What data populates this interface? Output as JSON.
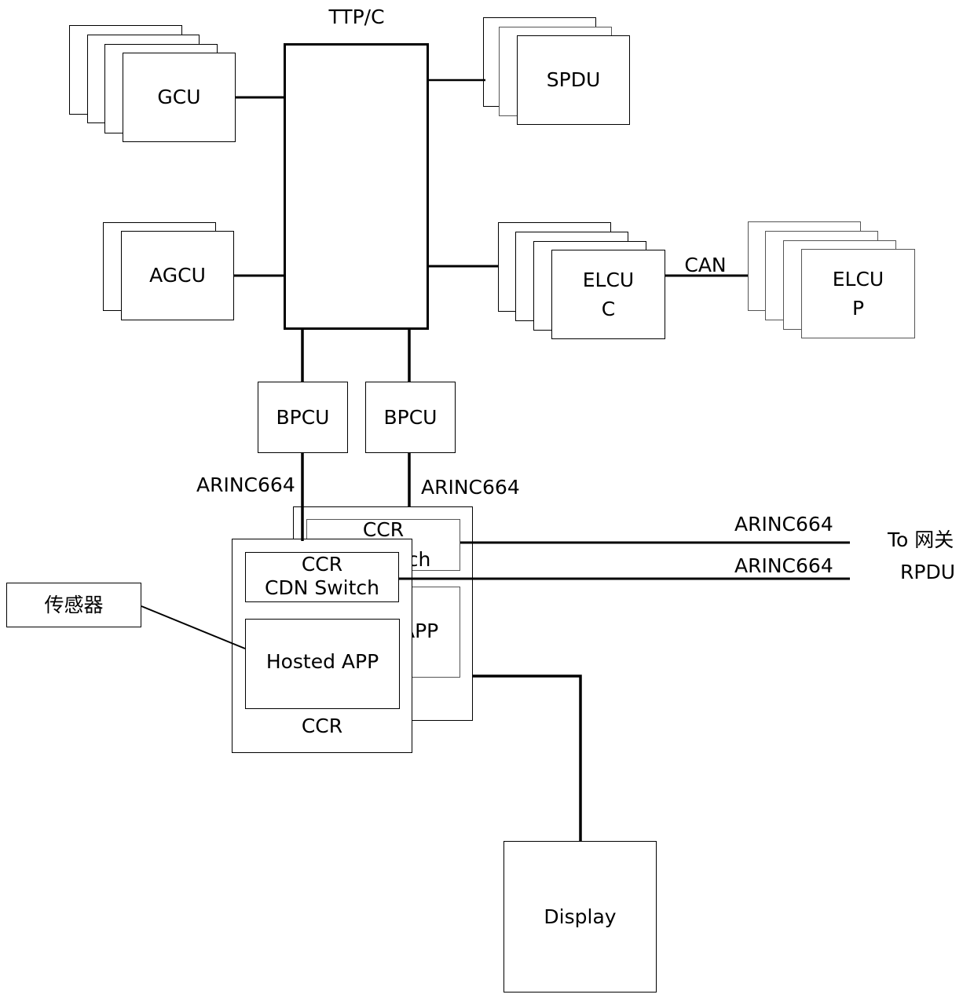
{
  "diagram": {
    "bus": {
      "label": "TTP/C"
    },
    "gcu": {
      "label": "GCU"
    },
    "agcu": {
      "label": "AGCU"
    },
    "spdu": {
      "label": "SPDU"
    },
    "elcu_c": {
      "line1": "ELCU",
      "line2": "C"
    },
    "elcu_p": {
      "line1": "ELCU",
      "line2": "P"
    },
    "can_link": {
      "label": "CAN"
    },
    "bpcu_left": {
      "label": "BPCU"
    },
    "bpcu_right": {
      "label": "BPCU"
    },
    "arinc_left": {
      "label": "ARINC664"
    },
    "arinc_right": {
      "label": "ARINC664"
    },
    "ccr_back": {
      "switch_line1": "CCR",
      "switch_line2_partial": "tch",
      "app_partial": "APP"
    },
    "ccr_front": {
      "switch_line1": "CCR",
      "switch_line2": "CDN Switch",
      "app": "Hosted APP",
      "footer": "CCR"
    },
    "sensor": {
      "label": "传感器"
    },
    "out_link_top": {
      "label": "ARINC664"
    },
    "out_link_bottom": {
      "label": "ARINC664"
    },
    "destination": {
      "line1": "To 网关",
      "line2": "RPDU"
    },
    "display": {
      "label": "Display"
    }
  }
}
